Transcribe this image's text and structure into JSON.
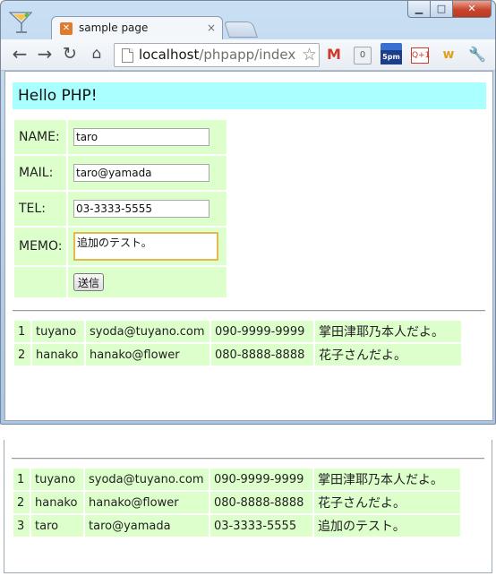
{
  "browser": {
    "tab_title": "sample page",
    "tab_close": "×",
    "url_host": "localhost",
    "url_path": "/phpapp/index",
    "window_controls": {
      "minimize": "▁",
      "maximize": "□",
      "close": "✕"
    },
    "nav": {
      "back": "←",
      "forward": "→",
      "reload": "↻",
      "home": "⌂",
      "star": "☆"
    },
    "extensions": {
      "gmail": "M",
      "count_badge": "0",
      "calendar_label": "5pm",
      "gplus": "Q+1",
      "w_badge": "w",
      "wrench": "🔧"
    }
  },
  "page": {
    "header": "Hello PHP!",
    "form": {
      "name_label": "NAME:",
      "name_value": "taro",
      "mail_label": "MAIL:",
      "mail_value": "taro@yamada",
      "tel_label": "TEL:",
      "tel_value": "03-3333-5555",
      "memo_label": "MEMO:",
      "memo_value": "追加のテスト。",
      "submit_label": "送信"
    },
    "records": [
      {
        "id": "1",
        "name": "tuyano",
        "mail": "syoda@tuyano.com",
        "tel": "090-9999-9999",
        "memo": "掌田津耶乃本人だよ。"
      },
      {
        "id": "2",
        "name": "hanako",
        "mail": "hanako@flower",
        "tel": "080-8888-8888",
        "memo": "花子さんだよ。"
      }
    ]
  },
  "after_submit": {
    "records": [
      {
        "id": "1",
        "name": "tuyano",
        "mail": "syoda@tuyano.com",
        "tel": "090-9999-9999",
        "memo": "掌田津耶乃本人だよ。"
      },
      {
        "id": "2",
        "name": "hanako",
        "mail": "hanako@flower",
        "tel": "080-8888-8888",
        "memo": "花子さんだよ。"
      },
      {
        "id": "3",
        "name": "taro",
        "mail": "taro@yamada",
        "tel": "03-3333-5555",
        "memo": "追加のテスト。"
      }
    ]
  },
  "colors": {
    "header_bg": "#aaffff",
    "cell_bg": "#ddffcc",
    "chrome_frame": "#b7d1ec"
  }
}
